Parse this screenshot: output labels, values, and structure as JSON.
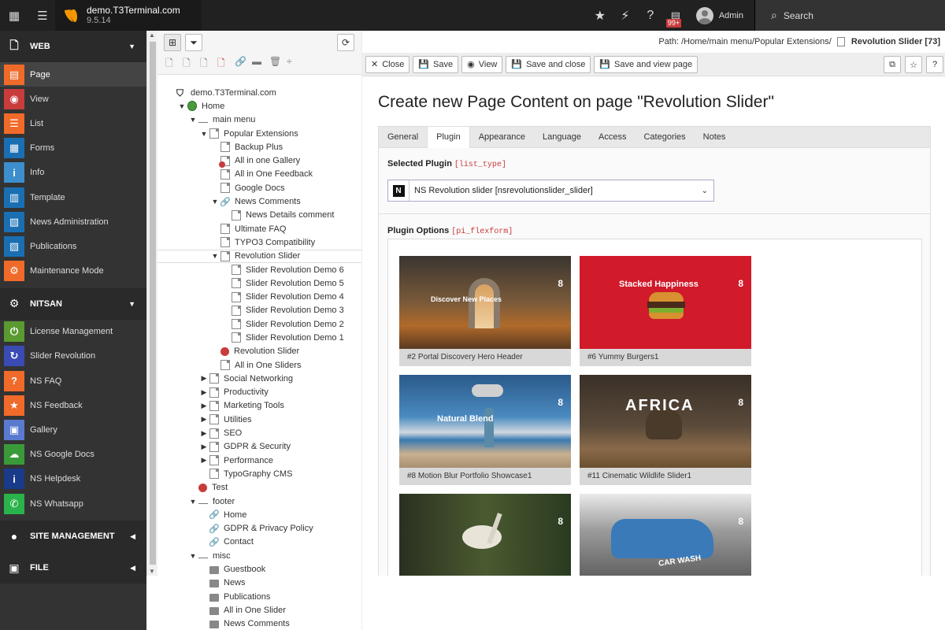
{
  "topbar": {
    "site_name": "demo.T3Terminal.com",
    "version": "9.5.14",
    "badge": "99+",
    "user": "Admin",
    "search_label": "Search"
  },
  "modules": {
    "web_label": "WEB",
    "web_items": [
      {
        "label": "Page",
        "color": "#f06a29"
      },
      {
        "label": "View",
        "color": "#c83c3c"
      },
      {
        "label": "List",
        "color": "#f06a29"
      },
      {
        "label": "Forms",
        "color": "#1a6fb3"
      },
      {
        "label": "Info",
        "color": "#3c8fcc"
      },
      {
        "label": "Template",
        "color": "#1a6fb3"
      },
      {
        "label": "News Administration",
        "color": "#1a6fb3"
      },
      {
        "label": "Publications",
        "color": "#1a6fb3"
      },
      {
        "label": "Maintenance Mode",
        "color": "#f06a29"
      }
    ],
    "nitsan_label": "NITSAN",
    "nitsan_items": [
      {
        "label": "License Management",
        "color": "#5a9a30"
      },
      {
        "label": "Slider Revolution",
        "color": "#3a4bb3"
      },
      {
        "label": "NS FAQ",
        "color": "#f06a29"
      },
      {
        "label": "NS Feedback",
        "color": "#f06a29"
      },
      {
        "label": "Gallery",
        "color": "#5a7ad0"
      },
      {
        "label": "NS Google Docs",
        "color": "#3a9a3a"
      },
      {
        "label": "NS Helpdesk",
        "color": "#1a3a8a"
      },
      {
        "label": "NS Whatsapp",
        "color": "#2ab34a"
      }
    ],
    "site_mgmt_label": "SITE MANAGEMENT",
    "file_label": "FILE"
  },
  "tree": [
    {
      "label": "demo.T3Terminal.com",
      "indent": 0,
      "icon": "typo3",
      "toggle": ""
    },
    {
      "label": "Home",
      "indent": 1,
      "icon": "globe",
      "toggle": "▼"
    },
    {
      "label": "main menu",
      "indent": 2,
      "icon": "separator",
      "toggle": "▼"
    },
    {
      "label": "Popular Extensions",
      "indent": 3,
      "icon": "page",
      "toggle": "▼"
    },
    {
      "label": "Backup Plus",
      "indent": 4,
      "icon": "page",
      "toggle": ""
    },
    {
      "label": "All in one Gallery",
      "indent": 4,
      "icon": "page-red",
      "toggle": ""
    },
    {
      "label": "All in One Feedback",
      "indent": 4,
      "icon": "page",
      "toggle": ""
    },
    {
      "label": "Google Docs",
      "indent": 4,
      "icon": "page",
      "toggle": ""
    },
    {
      "label": "News Comments",
      "indent": 4,
      "icon": "link",
      "toggle": "▼"
    },
    {
      "label": "News Details comment",
      "indent": 5,
      "icon": "page",
      "toggle": ""
    },
    {
      "label": "Ultimate FAQ",
      "indent": 4,
      "icon": "page",
      "toggle": ""
    },
    {
      "label": "TYPO3 Compatibility",
      "indent": 4,
      "icon": "page",
      "toggle": ""
    },
    {
      "label": "Revolution Slider",
      "indent": 4,
      "icon": "page",
      "toggle": "▼",
      "selected": true
    },
    {
      "label": "Slider Revolution Demo 6",
      "indent": 5,
      "icon": "page",
      "toggle": ""
    },
    {
      "label": "Slider Revolution Demo 5",
      "indent": 5,
      "icon": "page",
      "toggle": ""
    },
    {
      "label": "Slider Revolution Demo 4",
      "indent": 5,
      "icon": "page",
      "toggle": ""
    },
    {
      "label": "Slider Revolution Demo 3",
      "indent": 5,
      "icon": "page",
      "toggle": ""
    },
    {
      "label": "Slider Revolution Demo 2",
      "indent": 5,
      "icon": "page",
      "toggle": ""
    },
    {
      "label": "Slider Revolution Demo 1",
      "indent": 5,
      "icon": "page",
      "toggle": ""
    },
    {
      "label": "Revolution Slider",
      "indent": 4,
      "icon": "red",
      "toggle": ""
    },
    {
      "label": "All in One Sliders",
      "indent": 4,
      "icon": "page",
      "toggle": ""
    },
    {
      "label": "Social Networking",
      "indent": 3,
      "icon": "page",
      "toggle": "▶"
    },
    {
      "label": "Productivity",
      "indent": 3,
      "icon": "page",
      "toggle": "▶"
    },
    {
      "label": "Marketing Tools",
      "indent": 3,
      "icon": "page",
      "toggle": "▶"
    },
    {
      "label": "Utilities",
      "indent": 3,
      "icon": "page",
      "toggle": "▶"
    },
    {
      "label": "SEO",
      "indent": 3,
      "icon": "page",
      "toggle": "▶"
    },
    {
      "label": "GDPR & Security",
      "indent": 3,
      "icon": "page",
      "toggle": "▶"
    },
    {
      "label": "Performance",
      "indent": 3,
      "icon": "page",
      "toggle": "▶"
    },
    {
      "label": "TypoGraphy CMS",
      "indent": 3,
      "icon": "page",
      "toggle": ""
    },
    {
      "label": "Test",
      "indent": 2,
      "icon": "red",
      "toggle": ""
    },
    {
      "label": "footer",
      "indent": 2,
      "icon": "separator",
      "toggle": "▼"
    },
    {
      "label": "Home",
      "indent": 3,
      "icon": "link",
      "toggle": ""
    },
    {
      "label": "GDPR & Privacy Policy",
      "indent": 3,
      "icon": "link",
      "toggle": ""
    },
    {
      "label": "Contact",
      "indent": 3,
      "icon": "link",
      "toggle": ""
    },
    {
      "label": "misc",
      "indent": 2,
      "icon": "separator",
      "toggle": "▼"
    },
    {
      "label": "Guestbook",
      "indent": 3,
      "icon": "folder",
      "toggle": ""
    },
    {
      "label": "News",
      "indent": 3,
      "icon": "folder",
      "toggle": ""
    },
    {
      "label": "Publications",
      "indent": 3,
      "icon": "folder",
      "toggle": ""
    },
    {
      "label": "All in One Slider",
      "indent": 3,
      "icon": "folder",
      "toggle": ""
    },
    {
      "label": "News Comments",
      "indent": 3,
      "icon": "folder",
      "toggle": ""
    }
  ],
  "path": {
    "label": "Path:",
    "value": "/Home/main menu/Popular Extensions/",
    "current": "Revolution Slider [73]"
  },
  "docheader": {
    "close": "Close",
    "save": "Save",
    "view": "View",
    "save_close": "Save and close",
    "save_view": "Save and view page"
  },
  "title": "Create new Page Content on page \"Revolution Slider\"",
  "tabs": [
    "General",
    "Plugin",
    "Appearance",
    "Language",
    "Access",
    "Categories",
    "Notes"
  ],
  "active_tab": "Plugin",
  "selected_plugin": {
    "label": "Selected Plugin",
    "field": "[list_type]",
    "value": "NS Revolution slider [nsrevolutionslider_slider]"
  },
  "plugin_options": {
    "label": "Plugin Options",
    "field": "[pi_flexform]"
  },
  "cards": [
    {
      "caption": "#2 Portal Discovery Hero Header",
      "num": "8",
      "overlay": "Discover New Places"
    },
    {
      "caption": "#6 Yummy Burgers1",
      "num": "8",
      "overlay": "Stacked Happiness"
    },
    {
      "caption": "#8 Motion Blur Portfolio Showcase1",
      "num": "8",
      "overlay": "Natural Blend"
    },
    {
      "caption": "#11 Cinematic Wildlife Slider1",
      "num": "8",
      "overlay": "AFRICA"
    },
    {
      "caption": "",
      "num": "8",
      "overlay": ""
    },
    {
      "caption": "",
      "num": "8",
      "overlay": "CAR WASH"
    }
  ]
}
